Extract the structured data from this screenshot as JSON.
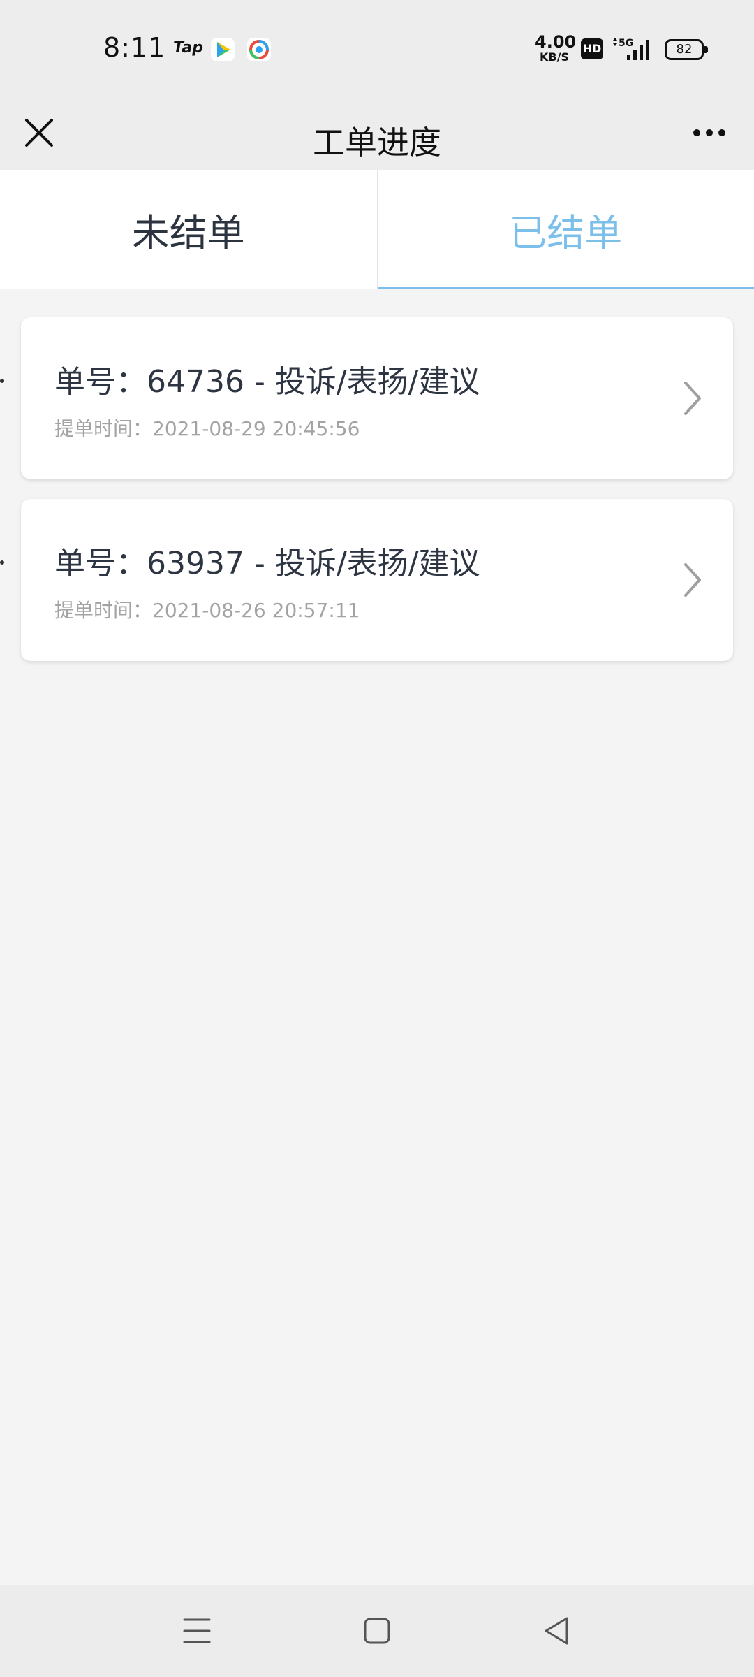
{
  "status_bar": {
    "time": "8:11",
    "tap_label": "Tap",
    "app_icons": [
      "video-app-icon",
      "browser-app-icon"
    ],
    "net_speed_value": "4.00",
    "net_speed_unit": "KB/S",
    "hd_label": "HD",
    "network_type": "5G",
    "battery_level": "82"
  },
  "header": {
    "title": "工单进度"
  },
  "tabs": [
    {
      "label": "未结单",
      "active": false
    },
    {
      "label": "已结单",
      "active": true
    }
  ],
  "orders": [
    {
      "title": "单号：64736 - 投诉/表扬/建议",
      "time": "提单时间：2021-08-29 20:45:56"
    },
    {
      "title": "单号：63937 - 投诉/表扬/建议",
      "time": "提单时间：2021-08-26 20:57:11"
    }
  ],
  "colors": {
    "accent": "#7cc0ea",
    "background": "#f4f4f4",
    "bar_background": "#ededed"
  }
}
